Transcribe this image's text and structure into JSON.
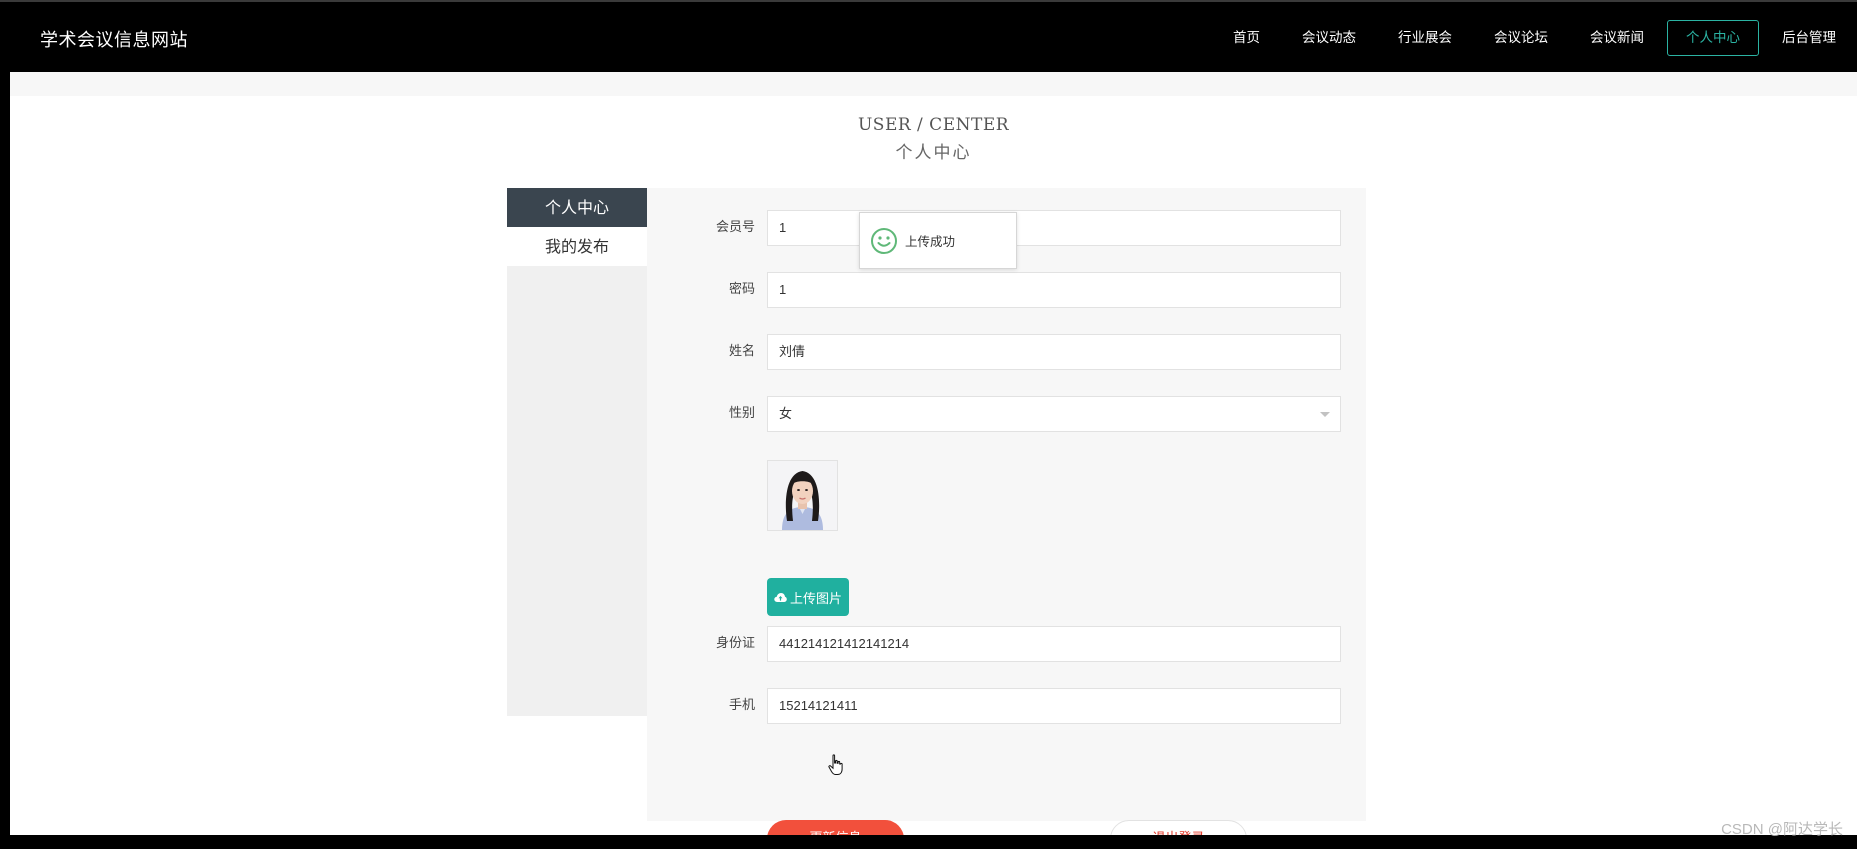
{
  "site": {
    "brand": "学术会议信息网站"
  },
  "nav": {
    "items": [
      {
        "label": "首页"
      },
      {
        "label": "会议动态"
      },
      {
        "label": "行业展会"
      },
      {
        "label": "会议论坛"
      },
      {
        "label": "会议新闻"
      },
      {
        "label": "个人中心",
        "active": true
      },
      {
        "label": "后台管理"
      }
    ]
  },
  "page": {
    "title_en": "USER / CENTER",
    "title_cn": "个人中心"
  },
  "sidebar": {
    "items": [
      {
        "label": "个人中心"
      },
      {
        "label": "我的发布"
      }
    ]
  },
  "form": {
    "member_no": {
      "label": "会员号",
      "value": "1"
    },
    "password": {
      "label": "密码",
      "value": "1"
    },
    "name": {
      "label": "姓名",
      "value": "刘倩"
    },
    "gender": {
      "label": "性别",
      "value": "女"
    },
    "upload_button": "上传图片",
    "id_card": {
      "label": "身份证",
      "value": "441214121412141214"
    },
    "phone": {
      "label": "手机",
      "value": "15214121411"
    },
    "update_button": "更新信息",
    "logout_button": "退出登录"
  },
  "toast": {
    "message": "上传成功"
  },
  "watermark": "CSDN @阿达学长",
  "colors": {
    "accent": "#2bb3a3",
    "upload": "#20b09f",
    "danger": "#f2503c",
    "sidebar_active": "#3a454f"
  },
  "icons": {
    "toast": "smile-icon",
    "upload": "cloud-upload-icon",
    "select": "chevron-down-icon"
  }
}
